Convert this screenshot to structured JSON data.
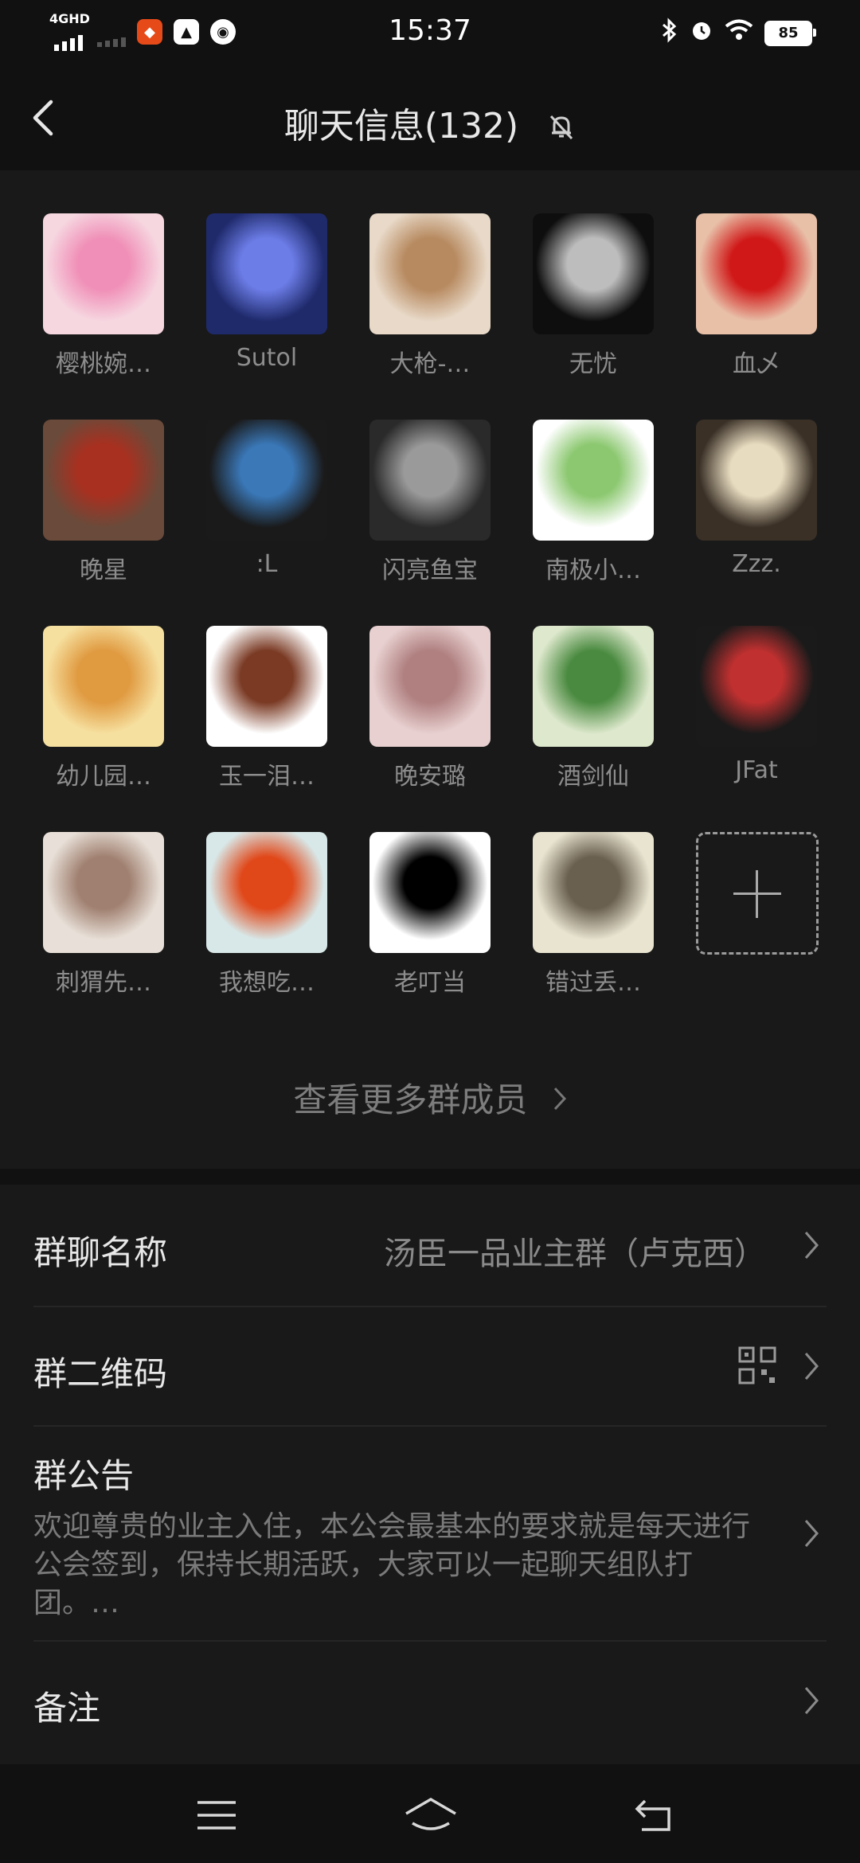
{
  "status_bar": {
    "network": "4GHD",
    "time": "15:37",
    "battery": "85"
  },
  "header": {
    "title": "聊天信息(132)"
  },
  "members": [
    {
      "name": "樱桃婉…",
      "colors": [
        "#f6d7e0",
        "#f090b8"
      ]
    },
    {
      "name": "Sutol",
      "colors": [
        "#1f2a6b",
        "#6c7de8"
      ]
    },
    {
      "name": "大枪-…",
      "colors": [
        "#e8d9c8",
        "#b78a60"
      ]
    },
    {
      "name": "无忧",
      "colors": [
        "#0e0e0e",
        "#bdbdbd"
      ]
    },
    {
      "name": "血乄",
      "colors": [
        "#e8c0a8",
        "#d01818"
      ]
    },
    {
      "name": "晚星",
      "colors": [
        "#6a4a3a",
        "#a83020"
      ]
    },
    {
      "name": ":L",
      "colors": [
        "#1a1a1a",
        "#3a78b8"
      ]
    },
    {
      "name": "闪亮鱼宝",
      "colors": [
        "#2a2a2a",
        "#9a9a9a"
      ]
    },
    {
      "name": "南极小…",
      "colors": [
        "#ffffff",
        "#8cc870"
      ]
    },
    {
      "name": "Zzz.",
      "colors": [
        "#3a3026",
        "#e8dcc0"
      ]
    },
    {
      "name": "幼儿园…",
      "colors": [
        "#f6e0a0",
        "#e09a40"
      ]
    },
    {
      "name": "玉一泪…",
      "colors": [
        "#ffffff",
        "#7a3a24"
      ]
    },
    {
      "name": "晚安璐",
      "colors": [
        "#e8d0d0",
        "#b08080"
      ]
    },
    {
      "name": "酒剑仙",
      "colors": [
        "#dde8cc",
        "#4a8a40"
      ]
    },
    {
      "name": "JFat",
      "colors": [
        "#1a1a1a",
        "#c03030"
      ]
    },
    {
      "name": "刺猬先…",
      "colors": [
        "#e8e0d8",
        "#a08070"
      ]
    },
    {
      "name": "我想吃…",
      "colors": [
        "#d8e8e8",
        "#e0481a"
      ]
    },
    {
      "name": "老叮当",
      "colors": [
        "#ffffff",
        "#000000"
      ]
    },
    {
      "name": "错过丢…",
      "colors": [
        "#e8e4d0",
        "#6a6050"
      ]
    }
  ],
  "view_more": {
    "label": "查看更多群成员"
  },
  "settings": {
    "group_name": {
      "label": "群聊名称",
      "value": "汤臣一品业主群（卢克西）"
    },
    "qr_code": {
      "label": "群二维码"
    },
    "notice": {
      "label": "群公告",
      "text": "欢迎尊贵的业主入住，本公会最基本的要求就是每天进行公会签到，保持长期活跃，大家可以一起聊天组队打团。…"
    },
    "remark": {
      "label": "备注"
    }
  }
}
